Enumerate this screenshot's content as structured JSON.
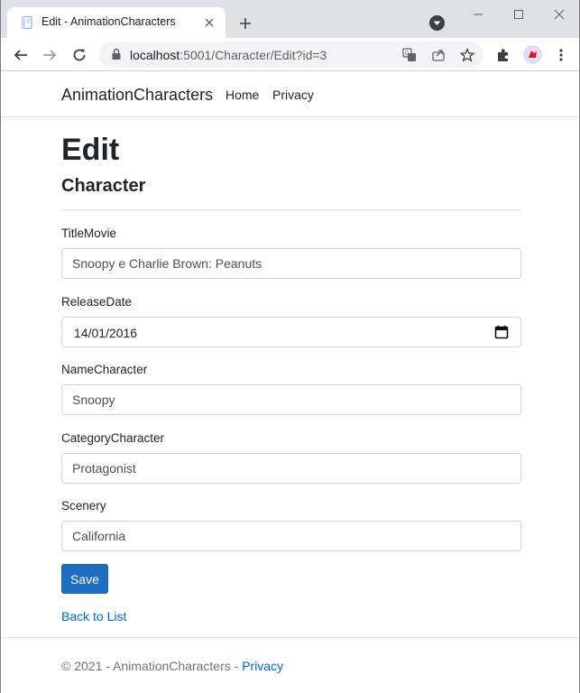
{
  "browser": {
    "tab_title": "Edit - AnimationCharacters",
    "url_host": "localhost",
    "url_path": ":5001/Character/Edit?id=3"
  },
  "navbar": {
    "brand": "AnimationCharacters",
    "links": [
      "Home",
      "Privacy"
    ]
  },
  "page": {
    "title": "Edit",
    "subtitle": "Character"
  },
  "form": {
    "fields": [
      {
        "label": "TitleMovie",
        "value": "Snoopy e Charlie Brown: Peanuts"
      },
      {
        "label": "ReleaseDate",
        "value": "14/01/2016"
      },
      {
        "label": "NameCharacter",
        "value": "Snoopy"
      },
      {
        "label": "CategoryCharacter",
        "value": "Protagonist"
      },
      {
        "label": "Scenery",
        "value": "California"
      }
    ],
    "save_label": "Save",
    "back_label": "Back to List"
  },
  "footer": {
    "text": "© 2021 - AnimationCharacters - ",
    "link": "Privacy"
  },
  "colors": {
    "primary_button": "#1b6ec2",
    "link": "#0366d6",
    "tabstrip": "#dee1e6"
  },
  "icons": [
    "page-favicon-icon",
    "close-icon",
    "plus-icon",
    "tab-search-icon",
    "minimize-icon",
    "maximize-icon",
    "window-close-icon",
    "back-arrow-icon",
    "forward-arrow-icon",
    "reload-icon",
    "lock-icon",
    "translate-icon",
    "share-icon",
    "star-icon",
    "extensions-icon",
    "profile-icon",
    "menu-dots-icon",
    "calendar-icon"
  ]
}
